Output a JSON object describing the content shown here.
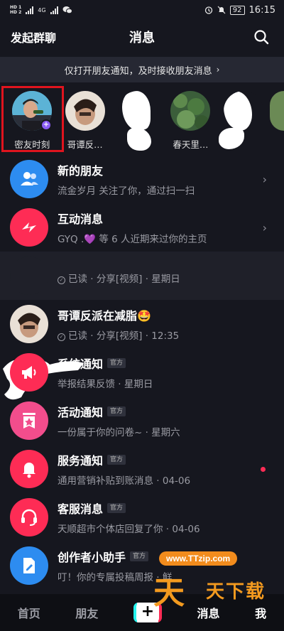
{
  "status_bar": {
    "hd_top": "HD 1",
    "hd_bottom": "HD 2",
    "network": "4G",
    "wechat_icon": "wechat-icon",
    "battery": "92",
    "time": "16:15"
  },
  "header": {
    "left_action": "发起群聊",
    "title": "消息",
    "search_icon": "search-icon"
  },
  "notice": {
    "text": "仅打开朋友通知，及时接收朋友消息",
    "chevron": "›"
  },
  "friends": [
    {
      "name": "密友时刻",
      "color": "#4aa0c9"
    },
    {
      "name": "哥谭反…",
      "color": "#8c6a58"
    },
    {
      "name": "",
      "color": "#ffffff"
    },
    {
      "name": "春天里…",
      "color": "#3e6b3c"
    },
    {
      "name": "",
      "color": "#6b8a55"
    }
  ],
  "messages": [
    {
      "title": "新的朋友",
      "sub": "流金岁月 关注了你，通过扫一扫",
      "icon": "people-icon",
      "color": "#2d8cf0",
      "chevron": "›"
    },
    {
      "title": "互动消息",
      "sub": "GYQ .💜 等 6 人近期来过你的主页",
      "icon": "lightning-icon",
      "color": "#fe2c55",
      "chevron": "›"
    },
    {
      "title": "",
      "sub_read": "已读",
      "sub": " · 分享[视频] · 星期日",
      "icon": "avatar-redacted",
      "color": "#ffffff"
    },
    {
      "title": "哥谭反派在减脂🤩",
      "sub_read": "已读",
      "sub": " · 分享[视频] · 12:35",
      "icon": "avatar",
      "color": "#8c6a58"
    },
    {
      "title": "系统通知",
      "official": "官方",
      "sub": "举报结果反馈 · 星期日",
      "icon": "megaphone-icon",
      "color": "#fe2c55"
    },
    {
      "title": "活动通知",
      "official": "官方",
      "sub": "一份属于你的问卷~ · 星期六",
      "icon": "star-bookmark-icon",
      "color": "#f24d8c"
    },
    {
      "title": "服务通知",
      "official": "官方",
      "sub": "通用营销补贴到账消息 · 04-06",
      "icon": "bell-icon",
      "color": "#fe2c55"
    },
    {
      "title": "客服消息",
      "official": "官方",
      "sub": "天顺超市个体店回复了你 · 04-06",
      "icon": "headset-icon",
      "color": "#fe2c55"
    },
    {
      "title": "创作者小助手",
      "official": "官方",
      "sub": "叮！你的专属投稿周报 · 鲜…",
      "icon": "edit-doc-icon",
      "color": "#2d8cf0"
    }
  ],
  "bottom_nav": {
    "home": "首页",
    "friends": "朋友",
    "create": "+",
    "messages": "消息",
    "me": "我"
  },
  "watermark": {
    "url": "www.TTzip.com",
    "big": "天",
    "small": "天下载"
  }
}
